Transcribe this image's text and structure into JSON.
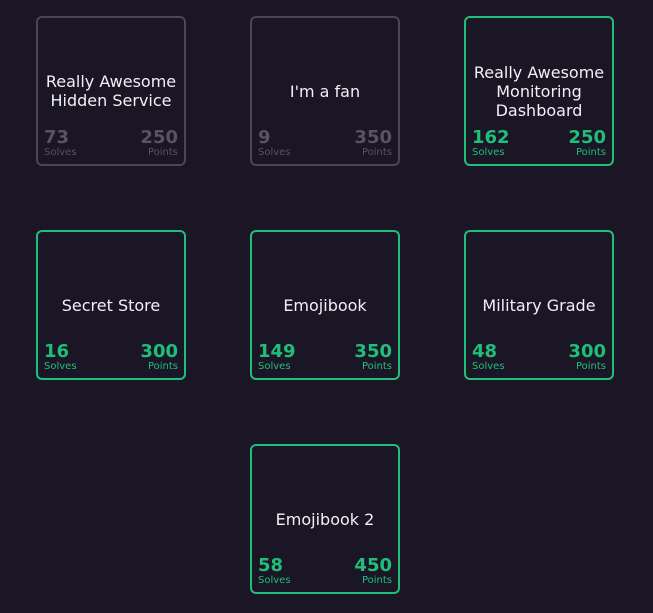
{
  "challenges": [
    {
      "title": "Really Awesome Hidden Service",
      "solves": "73",
      "points": "250",
      "solved": false
    },
    {
      "title": "I'm a fan",
      "solves": "9",
      "points": "350",
      "solved": false
    },
    {
      "title": "Really Awesome Monitoring Dashboard",
      "solves": "162",
      "points": "250",
      "solved": true
    },
    {
      "title": "Secret Store",
      "solves": "16",
      "points": "300",
      "solved": true
    },
    {
      "title": "Emojibook",
      "solves": "149",
      "points": "350",
      "solved": true
    },
    {
      "title": "Military Grade",
      "solves": "48",
      "points": "300",
      "solved": true
    },
    {
      "title": "Emojibook 2",
      "solves": "58",
      "points": "450",
      "solved": true
    }
  ],
  "labels": {
    "solves": "Solves",
    "points": "Points"
  },
  "colors": {
    "background": "#1a1625",
    "solved_accent": "#1fbf7a",
    "unsolved_border": "#4a4655",
    "unsolved_text": "#575363",
    "title_text": "#f2f0f5"
  }
}
